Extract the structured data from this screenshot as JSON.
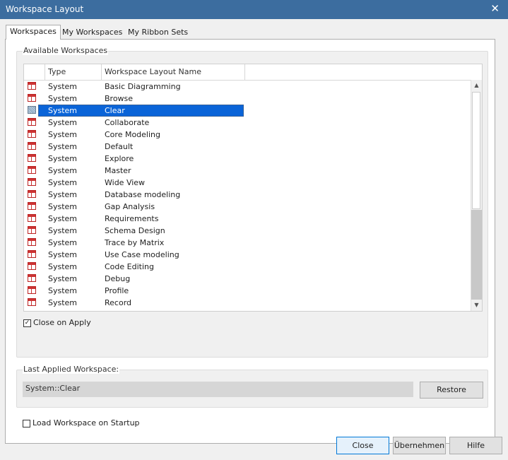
{
  "window": {
    "title": "Workspace Layout",
    "close_glyph": "✕"
  },
  "tabs": [
    {
      "label": "Workspaces",
      "active": true
    },
    {
      "label": "My Workspaces",
      "active": false
    },
    {
      "label": "My Ribbon Sets",
      "active": false
    }
  ],
  "available": {
    "label": "Available Workspaces",
    "columns": [
      "Type",
      "Workspace Layout Name"
    ],
    "rows": [
      {
        "type": "System",
        "name": "Basic Diagramming"
      },
      {
        "type": "System",
        "name": "Browse"
      },
      {
        "type": "System",
        "name": "Clear",
        "selected": true
      },
      {
        "type": "System",
        "name": "Collaborate"
      },
      {
        "type": "System",
        "name": "Core Modeling"
      },
      {
        "type": "System",
        "name": "Default"
      },
      {
        "type": "System",
        "name": "Explore"
      },
      {
        "type": "System",
        "name": "Master"
      },
      {
        "type": "System",
        "name": "Wide View"
      },
      {
        "type": "System",
        "name": "Database modeling"
      },
      {
        "type": "System",
        "name": "Gap Analysis"
      },
      {
        "type": "System",
        "name": "Requirements"
      },
      {
        "type": "System",
        "name": "Schema Design"
      },
      {
        "type": "System",
        "name": "Trace by Matrix"
      },
      {
        "type": "System",
        "name": "Use Case modeling"
      },
      {
        "type": "System",
        "name": "Code Editing"
      },
      {
        "type": "System",
        "name": "Debug"
      },
      {
        "type": "System",
        "name": "Profile"
      },
      {
        "type": "System",
        "name": "Record"
      }
    ],
    "close_on_apply": {
      "label": "Close on Apply",
      "checked": true
    }
  },
  "last_applied": {
    "label": "Last Applied Workspace:",
    "value": "System::Clear",
    "restore_label": "Restore"
  },
  "load_on_startup": {
    "label": "Load Workspace on Startup",
    "checked": false
  },
  "footer": {
    "close_label": "Close",
    "apply_label": "Übernehmen",
    "help_label": "Hilfe"
  },
  "icons": {
    "workspace_icon": "workspace-layout-icon",
    "scroll_up": "▲",
    "scroll_down": "▼",
    "check": "✓"
  },
  "colors": {
    "titlebar": "#3c6d9f",
    "selection": "#0a64d8"
  }
}
